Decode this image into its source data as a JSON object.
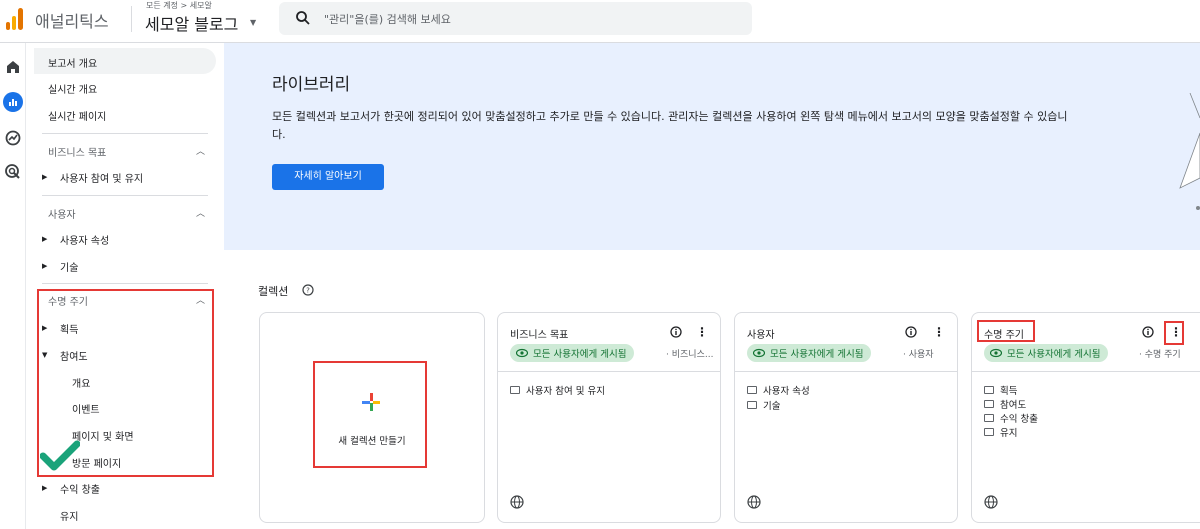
{
  "header": {
    "app_name": "애널리틱스",
    "breadcrumb": "모든 계정 > 세모알",
    "property_name": "세모알 블로그",
    "search_placeholder": "\"관리\"을(를) 검색해 보세요"
  },
  "sidebar": {
    "top_items": [
      "보고서 개요",
      "실시간 개요",
      "실시간 페이지"
    ],
    "sections": {
      "business": "비즈니스 목표",
      "business_items": [
        "사용자 참여 및 유지"
      ],
      "user": "사용자",
      "user_items": [
        "사용자 속성",
        "기술"
      ],
      "lifecycle": "수명 주기",
      "lifecycle_items": [
        "획득",
        "참여도"
      ],
      "engagement_sub": [
        "개요",
        "이벤트",
        "페이지 및 화면",
        "방문 페이지"
      ],
      "more_items": [
        "수익 창출",
        "유지"
      ]
    }
  },
  "banner": {
    "title": "라이브러리",
    "text": "모든 컬렉션과 보고서가 한곳에 정리되어 있어 맞춤설정하고 추가로 만들 수 있습니다. 관리자는 컬렉션을 사용하여 왼쪽 탐색 메뉴에서 보고서의 모양을 맞춤설정할 수 있습니다.",
    "button": "자세히 알아보기"
  },
  "collections": {
    "title": "컬렉션",
    "new_label": "새 컬렉션 만들기",
    "cards": [
      {
        "title": "비즈니스 목표",
        "chip": "모든 사용자에게 게시됨",
        "sub": "비즈니스...",
        "items": [
          "사용자 참여 및 유지"
        ]
      },
      {
        "title": "사용자",
        "chip": "모든 사용자에게 게시됨",
        "sub": "사용자",
        "items": [
          "사용자 속성",
          "기술"
        ]
      },
      {
        "title": "수명 주기",
        "chip": "모든 사용자에게 게시됨",
        "sub": "수명 주기",
        "items": [
          "획득",
          "참여도",
          "수익 창출",
          "유지"
        ]
      }
    ]
  },
  "colors": {
    "accent": "#1a73e8",
    "chip_bg": "#ceead6",
    "chip_text": "#137333",
    "highlight": "#e53935",
    "check": "#1aa37a"
  },
  "icons": [
    "home-icon",
    "reports-icon",
    "explore-icon",
    "advertising-icon",
    "search-icon",
    "help-icon",
    "info-icon",
    "more-vert-icon",
    "eye-icon",
    "folder-icon",
    "globe-icon",
    "plus-icon",
    "check-icon"
  ]
}
